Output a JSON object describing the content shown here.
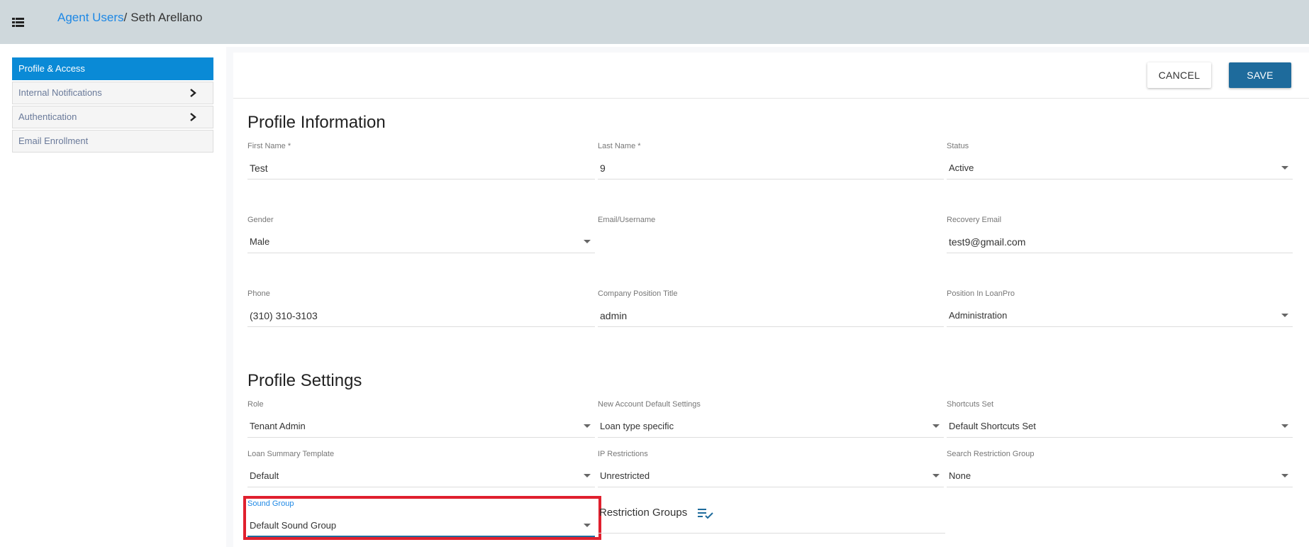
{
  "header": {
    "breadcrumb_link": "Agent Users",
    "breadcrumb_separator": "/",
    "breadcrumb_current": "Seth Arellano"
  },
  "sidebar": {
    "items": [
      {
        "label": "Profile & Access",
        "active": true
      },
      {
        "label": "Internal Notifications",
        "has_chevron": true
      },
      {
        "label": "Authentication",
        "has_chevron": true
      },
      {
        "label": "Email Enrollment"
      }
    ]
  },
  "actions": {
    "cancel_label": "CANCEL",
    "save_label": "SAVE"
  },
  "profile_info": {
    "title": "Profile Information",
    "first_name": {
      "label": "First Name *",
      "value": "Test"
    },
    "last_name": {
      "label": "Last Name *",
      "value": "9"
    },
    "status": {
      "label": "Status",
      "value": "Active"
    },
    "gender": {
      "label": "Gender",
      "value": "Male"
    },
    "email": {
      "label": "Email/Username",
      "value": ""
    },
    "recovery_email": {
      "label": "Recovery Email",
      "value": "test9@gmail.com"
    },
    "phone": {
      "label": "Phone",
      "value": "(310) 310-3103"
    },
    "company_position": {
      "label": "Company Position Title",
      "value": "admin"
    },
    "position_loanpro": {
      "label": "Position In LoanPro",
      "value": "Administration"
    }
  },
  "profile_settings": {
    "title": "Profile Settings",
    "role": {
      "label": "Role",
      "value": "Tenant Admin"
    },
    "new_account_defaults": {
      "label": "New Account Default Settings",
      "value": "Loan type specific"
    },
    "shortcuts_set": {
      "label": "Shortcuts Set",
      "value": "Default Shortcuts Set"
    },
    "loan_summary_template": {
      "label": "Loan Summary Template",
      "value": "Default"
    },
    "ip_restrictions": {
      "label": "IP Restrictions",
      "value": "Unrestricted"
    },
    "search_restriction_group": {
      "label": "Search Restriction Group",
      "value": "None"
    },
    "sound_group": {
      "label": "Sound Group",
      "value": "Default Sound Group"
    },
    "restriction_groups": {
      "label": "Restriction Groups"
    }
  },
  "colors": {
    "accent": "#0a8ad6",
    "save_button": "#1e6b9c",
    "highlight": "#e0202e",
    "topbar": "#cfd8dc"
  }
}
